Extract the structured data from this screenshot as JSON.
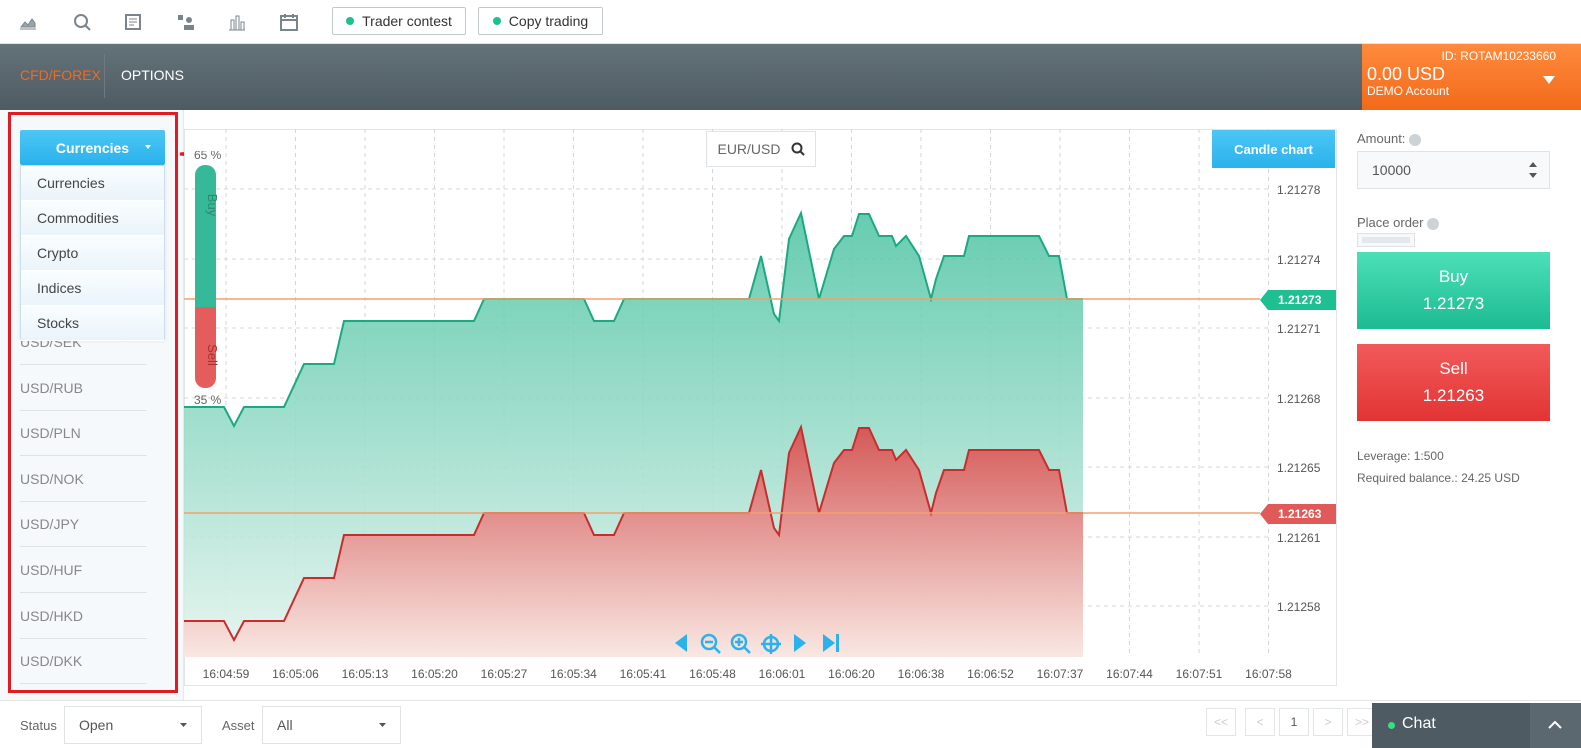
{
  "toolbar": {
    "icons": [
      "area-chart-icon",
      "magnifier-chart-icon",
      "news-icon",
      "network-icon",
      "bar-chart-icon",
      "calendar-icon"
    ],
    "trader_contest": "Trader contest",
    "copy_trading": "Copy trading"
  },
  "header": {
    "tabs": [
      "CFD/FOREX",
      "OPTIONS"
    ],
    "active_tab": "CFD/FOREX",
    "account": {
      "id": "ID: ROTAM10233660",
      "balance": "0.00 USD",
      "type": "DEMO Account"
    }
  },
  "left": {
    "dropdown_label": "Currencies",
    "dropdown_options": [
      "Currencies",
      "Commodities",
      "Crypto",
      "Indices",
      "Stocks"
    ],
    "symbols": [
      "USD/SEK",
      "USD/RUB",
      "USD/PLN",
      "USD/NOK",
      "USD/JPY",
      "USD/HUF",
      "USD/HKD",
      "USD/DKK"
    ]
  },
  "chart": {
    "symbol": "EUR/USD",
    "chart_type_button": "Candle chart",
    "sentiment": {
      "buy_label": "Buy",
      "sell_label": "Sell",
      "top_pct": "65 %",
      "bottom_pct": "35 %",
      "buy_share": 0.65
    },
    "price_ticks": [
      "1.21278",
      "1.21274",
      "1.21271",
      "1.21268",
      "1.21265",
      "1.21261",
      "1.21258"
    ],
    "time_ticks": [
      "16:04:59",
      "16:05:06",
      "16:05:13",
      "16:05:20",
      "16:05:27",
      "16:05:34",
      "16:05:41",
      "16:05:48",
      "16:06:01",
      "16:06:20",
      "16:06:38",
      "16:06:52",
      "16:07:37",
      "16:07:44",
      "16:07:51",
      "16:07:58"
    ],
    "buy_tag": "1.21273",
    "sell_tag": "1.21263",
    "colors": {
      "buy": "#1dbf93",
      "sell": "#e23c3c",
      "accent": "#2ab2ec",
      "orange": "#f26a1a"
    }
  },
  "order": {
    "amount_label": "Amount:",
    "amount_value": "10000",
    "place_order_label": "Place order",
    "buy_label": "Buy",
    "buy_price": "1.21273",
    "sell_label": "Sell",
    "sell_price": "1.21263",
    "leverage": "Leverage: 1:500",
    "required_balance": "Required balance.: 24.25 USD"
  },
  "bottom": {
    "status_label": "Status",
    "status_value": "Open",
    "asset_label": "Asset",
    "asset_value": "All",
    "pagination": [
      "<<",
      "<",
      "1",
      ">",
      ">>"
    ],
    "chat_label": "Chat"
  }
}
